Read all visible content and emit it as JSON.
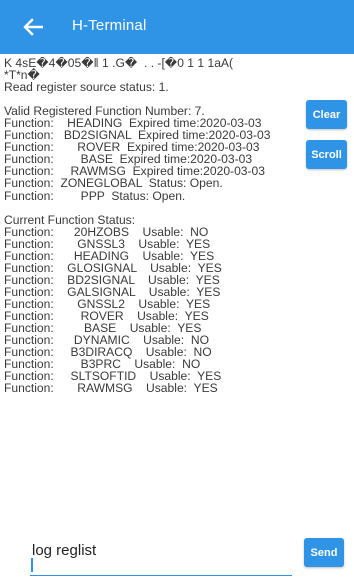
{
  "appbar": {
    "title": "H-Terminal",
    "back_icon": "arrow-left-icon",
    "color": "#2f94e6"
  },
  "console": {
    "lines": [
      "K 4sE�4�05�‖ 1 .G�  . . -[�0 1 1 1aA(",
      "*T*n�",
      "Read register source status: 1.",
      "",
      "Valid Registered Function Number: 7.",
      "Function:    HEADING  Expired time:2020-03-03",
      "Function:   BD2SIGNAL  Expired time:2020-03-03",
      "Function:       ROVER  Expired time:2020-03-03",
      "Function:        BASE  Expired time:2020-03-03",
      "Function:     RAWMSG  Expired time:2020-03-03",
      "Function:  ZONEGLOBAL  Status: Open.",
      "Function:        PPP  Status: Open.",
      "",
      "Current Function Status:",
      "Function:      20HZOBS    Usable:  NO",
      "Function:       GNSSL3    Usable:  YES",
      "Function:      HEADING    Usable:  YES",
      "Function:    GLOSIGNAL    Usable:  YES",
      "Function:    BD2SIGNAL    Usable:  YES",
      "Function:    GALSIGNAL    Usable:  YES",
      "Function:       GNSSL2    Usable:  YES",
      "Function:        ROVER    Usable:  YES",
      "Function:         BASE    Usable:  YES",
      "Function:      DYNAMIC    Usable:  NO",
      "Function:     B3DIRACQ    Usable:  NO",
      "Function:        B3PRC    Usable:  NO",
      "Function:     SLTSOFTID    Usable:  YES",
      "Function:       RAWMSG    Usable:  YES"
    ]
  },
  "buttons": {
    "clear_label": "Clear",
    "scroll_label": "Scroll",
    "send_label": "Send"
  },
  "command": {
    "value": "log reglist"
  }
}
